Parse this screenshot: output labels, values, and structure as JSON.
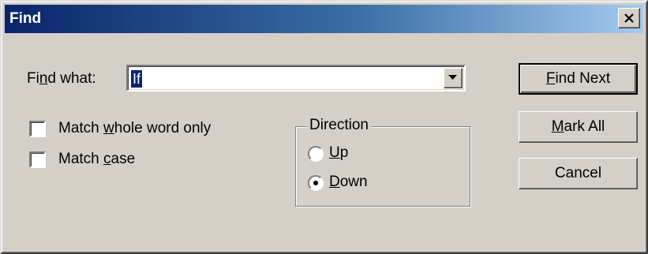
{
  "window": {
    "title": "Find",
    "close_icon": "close-icon"
  },
  "find_what": {
    "label_pre": "Fi",
    "label_accel": "n",
    "label_post": "d what:",
    "value": "If"
  },
  "options": {
    "match_whole_word": {
      "label_pre": "Match ",
      "label_accel": "w",
      "label_post": "hole word only",
      "checked": false
    },
    "match_case": {
      "label_pre": "Match ",
      "label_accel": "c",
      "label_post": "ase",
      "checked": false
    }
  },
  "direction": {
    "legend": "Direction",
    "up": {
      "label_accel": "U",
      "label_post": "p",
      "selected": false
    },
    "down": {
      "label_accel": "D",
      "label_post": "own",
      "selected": true
    }
  },
  "buttons": {
    "find_next": {
      "label_accel": "F",
      "label_post": "ind Next"
    },
    "mark_all": {
      "label_accel": "M",
      "label_post": "ark All"
    },
    "cancel": {
      "label": "Cancel"
    }
  },
  "colors": {
    "title_gradient_start": "#0a246a",
    "title_gradient_end": "#a6caf0",
    "dialog_background": "#d4d0c8",
    "selection": "#0a246a"
  }
}
